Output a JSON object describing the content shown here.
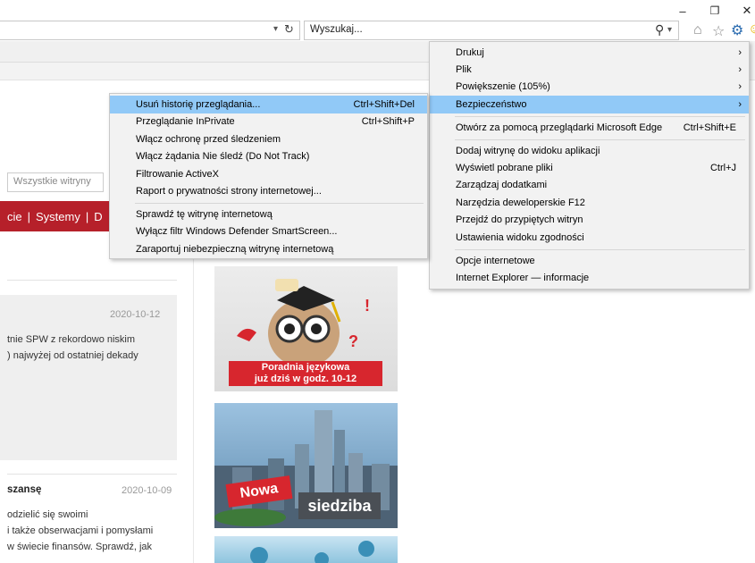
{
  "window": {
    "minimize": "–",
    "restore": "❐",
    "close": "✕"
  },
  "address": {
    "dropdown": "▾",
    "refresh": "↻"
  },
  "search": {
    "placeholder": "Wyszukaj...",
    "icon": "⚲",
    "dropdown": "▾"
  },
  "toolbar_icons": {
    "home": "⌂",
    "favorites": "☆",
    "tools": "⚙",
    "smiley": "☺"
  },
  "page": {
    "site_selector": "Wszystkie witryny",
    "nav": [
      "cie",
      "|",
      "Systemy",
      "|",
      "D"
    ],
    "articles": [
      {
        "date": "2020-10-12",
        "lines": [
          "tnie SPW z rekordowo niskim",
          ") najwyżej od ostatniej dekady"
        ]
      },
      {
        "title": "szansę",
        "date": "2020-10-09",
        "lines": [
          "odzielić się swoimi",
          "i także obserwacjami i pomysłami",
          "w świecie finansów. Sprawdź, jak"
        ]
      }
    ],
    "banner1": {
      "line1": "Poradnia językowa",
      "line2": "już dziś w godz. 10-12"
    },
    "banner2": {
      "word1": "Nowa",
      "word2": "siedziba"
    }
  },
  "tools_menu": [
    {
      "label": "Drukuj",
      "arrow": "›"
    },
    {
      "label": "Plik",
      "arrow": "›"
    },
    {
      "label": "Powiększenie (105%)",
      "arrow": "›"
    },
    {
      "label": "Bezpieczeństwo",
      "arrow": "›"
    },
    {
      "label": "Otwórz za pomocą przeglądarki Microsoft Edge",
      "shortcut": "Ctrl+Shift+E"
    },
    {
      "label": "Dodaj witrynę do widoku aplikacji"
    },
    {
      "label": "Wyświetl pobrane pliki",
      "shortcut": "Ctrl+J"
    },
    {
      "label": "Zarządzaj dodatkami"
    },
    {
      "label": "Narzędzia deweloperskie F12"
    },
    {
      "label": "Przejdź do przypiętych witryn"
    },
    {
      "label": "Ustawienia widoku zgodności"
    },
    {
      "label": "Opcje internetowe"
    },
    {
      "label": "Internet Explorer — informacje"
    }
  ],
  "security_menu": [
    {
      "label": "Usuń historię przeglądania...",
      "shortcut": "Ctrl+Shift+Del"
    },
    {
      "label": "Przeglądanie InPrivate",
      "shortcut": "Ctrl+Shift+P"
    },
    {
      "label": "Włącz ochronę przed śledzeniem"
    },
    {
      "label": "Włącz żądania Nie śledź (Do Not Track)"
    },
    {
      "label": "Filtrowanie ActiveX"
    },
    {
      "label": "Raport o prywatności strony internetowej..."
    },
    {
      "label": "Sprawdź tę witrynę internetową"
    },
    {
      "label": "Wyłącz filtr Windows Defender SmartScreen..."
    },
    {
      "label": "Zaraportuj niebezpieczną witrynę internetową"
    }
  ],
  "colors": {
    "accent_red": "#b6202a",
    "highlight": "#91c9f7"
  }
}
